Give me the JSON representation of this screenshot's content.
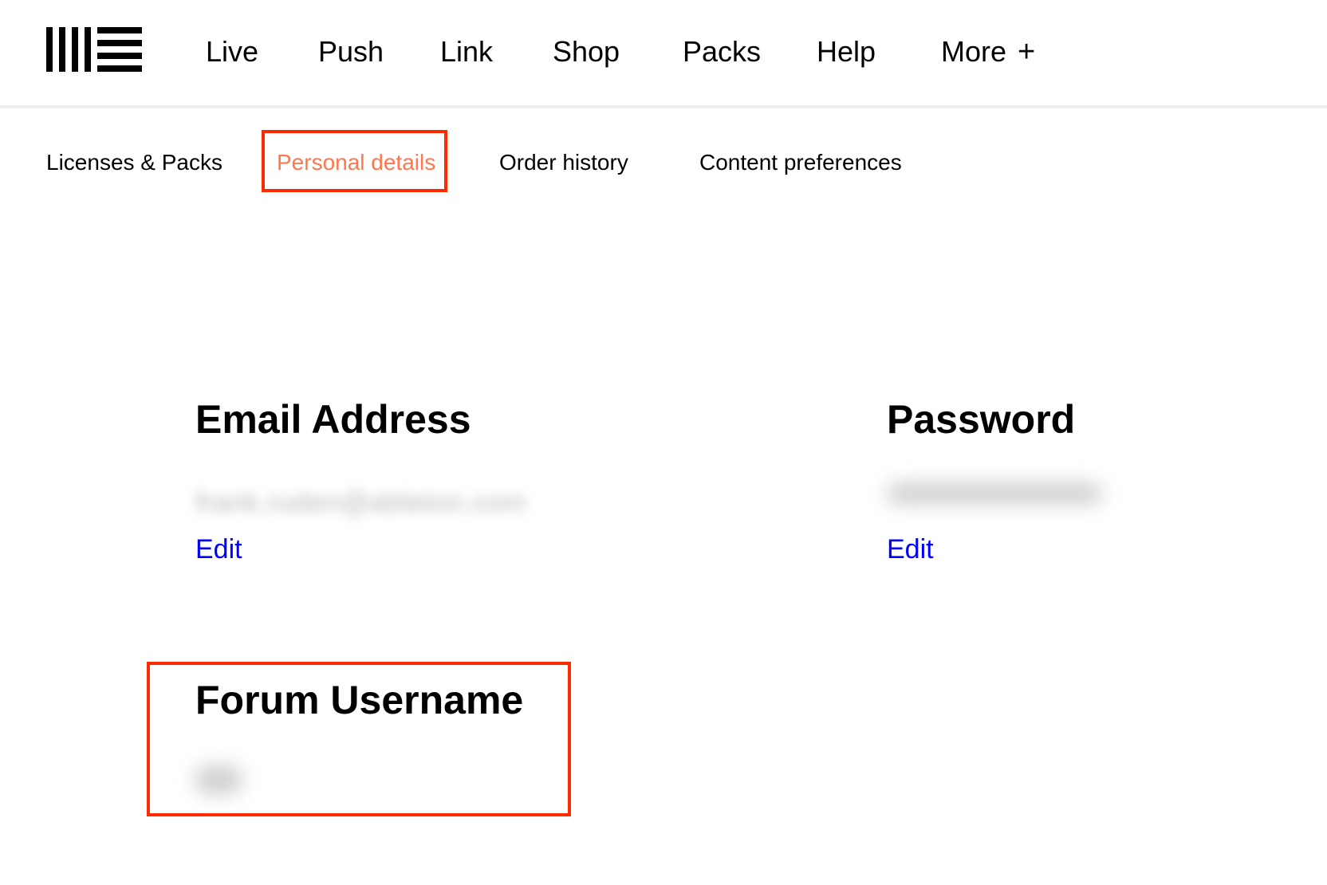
{
  "header": {
    "logo": "ableton-logo",
    "nav": [
      {
        "label": "Live"
      },
      {
        "label": "Push"
      },
      {
        "label": "Link"
      },
      {
        "label": "Shop"
      },
      {
        "label": "Packs"
      },
      {
        "label": "Help"
      },
      {
        "label": "More",
        "icon": "plus-icon",
        "icon_glyph": "+"
      }
    ]
  },
  "subnav": {
    "items": [
      {
        "label": "Licenses & Packs",
        "active": false
      },
      {
        "label": "Personal details",
        "active": true
      },
      {
        "label": "Order history",
        "active": false
      },
      {
        "label": "Content preferences",
        "active": false
      }
    ]
  },
  "account": {
    "email": {
      "title": "Email Address",
      "value": "frank.ruden@ableton.com",
      "value_state": "blurred",
      "edit_label": "Edit"
    },
    "password": {
      "title": "Password",
      "value": "••••••••••••••••",
      "value_state": "blurred",
      "edit_label": "Edit"
    },
    "forum_username": {
      "title": "Forum Username",
      "value": "fru",
      "value_state": "blurred"
    }
  },
  "colors": {
    "active_tab": "#ff764d",
    "annotation": "#ff2a00",
    "link": "#0000ff",
    "header_border": "#eeeeee"
  }
}
